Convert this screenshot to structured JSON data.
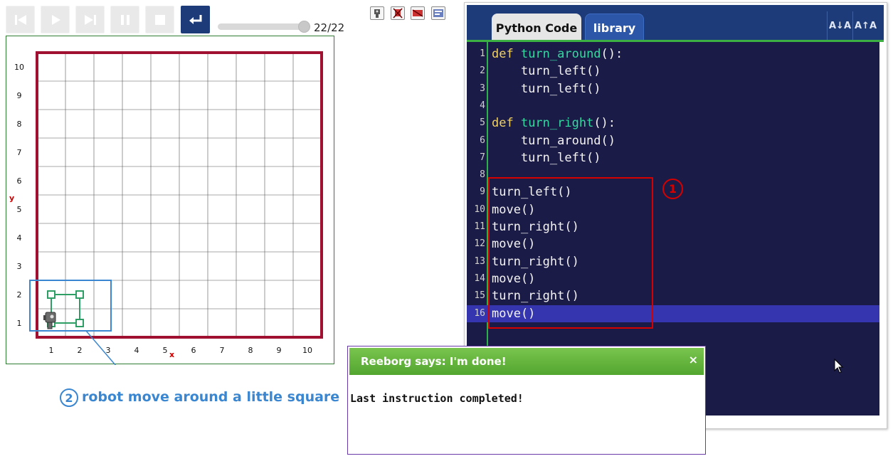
{
  "toolbar": {
    "buttons": [
      "go-to-start",
      "run",
      "step",
      "pause",
      "stop",
      "reload"
    ],
    "step_counter": "22/22",
    "speed_level_fraction": 0.92,
    "mini_icons": [
      "robot-icon",
      "remove-robot-icon",
      "world-icon",
      "edit-world-icon"
    ]
  },
  "world": {
    "size": 10,
    "x_label": "x",
    "y_label": "y",
    "x_ticks": [
      "1",
      "2",
      "3",
      "4",
      "5",
      "6",
      "7",
      "8",
      "9",
      "10"
    ],
    "y_ticks": [
      "1",
      "2",
      "3",
      "4",
      "5",
      "6",
      "7",
      "8",
      "9",
      "10"
    ],
    "trace": [
      [
        1,
        1
      ],
      [
        2,
        1
      ],
      [
        2,
        2
      ],
      [
        1,
        2
      ],
      [
        1,
        1
      ]
    ],
    "robot_position": [
      1,
      1
    ],
    "colors": {
      "wall": "#a01030",
      "trace": "#2e9e64",
      "highlight": "#3a86d0"
    }
  },
  "annotation": {
    "number": "2",
    "text": "robot move around a little square"
  },
  "editor": {
    "tabs": [
      {
        "label": "Python Code",
        "active": true
      },
      {
        "label": "library",
        "active": false
      }
    ],
    "font_buttons": [
      "A↓A",
      "A↑A"
    ],
    "active_line": 16,
    "lines": [
      {
        "n": "1",
        "parts": [
          {
            "t": "def ",
            "c": "kw"
          },
          {
            "t": "turn_around",
            "c": "fn"
          },
          {
            "t": "():",
            "c": ""
          }
        ]
      },
      {
        "n": "2",
        "parts": [
          {
            "t": "    turn_left()",
            "c": ""
          }
        ]
      },
      {
        "n": "3",
        "parts": [
          {
            "t": "    turn_left()",
            "c": ""
          }
        ]
      },
      {
        "n": "4",
        "parts": []
      },
      {
        "n": "5",
        "parts": [
          {
            "t": "def ",
            "c": "kw"
          },
          {
            "t": "turn_right",
            "c": "fn"
          },
          {
            "t": "():",
            "c": ""
          }
        ]
      },
      {
        "n": "6",
        "parts": [
          {
            "t": "    turn_around()",
            "c": ""
          }
        ]
      },
      {
        "n": "7",
        "parts": [
          {
            "t": "    turn_left()",
            "c": ""
          }
        ]
      },
      {
        "n": "8",
        "parts": []
      },
      {
        "n": "9",
        "parts": [
          {
            "t": "turn_left()",
            "c": ""
          }
        ]
      },
      {
        "n": "10",
        "parts": [
          {
            "t": "move()",
            "c": ""
          }
        ]
      },
      {
        "n": "11",
        "parts": [
          {
            "t": "turn_right()",
            "c": ""
          }
        ]
      },
      {
        "n": "12",
        "parts": [
          {
            "t": "move()",
            "c": ""
          }
        ]
      },
      {
        "n": "13",
        "parts": [
          {
            "t": "turn_right()",
            "c": ""
          }
        ]
      },
      {
        "n": "14",
        "parts": [
          {
            "t": "move()",
            "c": ""
          }
        ]
      },
      {
        "n": "15",
        "parts": [
          {
            "t": "turn_right()",
            "c": ""
          }
        ]
      },
      {
        "n": "16",
        "parts": [
          {
            "t": "move()",
            "c": ""
          }
        ]
      }
    ],
    "highlight_number": "1"
  },
  "dialog": {
    "title": "Reeborg says: I'm done!",
    "close": "×",
    "message": "Last instruction completed!"
  }
}
